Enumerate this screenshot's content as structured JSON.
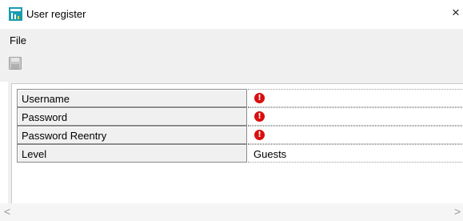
{
  "window": {
    "title": "User register",
    "close_glyph": "×",
    "icon": "app-register-icon"
  },
  "menu": {
    "file_label": "File"
  },
  "toolbar": {
    "save_icon": "save-disk-icon"
  },
  "grid": {
    "rows": [
      {
        "label": "Username",
        "value": "",
        "error": true
      },
      {
        "label": "Password",
        "value": "",
        "error": true
      },
      {
        "label": "Password Reentry",
        "value": "",
        "error": true
      },
      {
        "label": "Level",
        "value": "Guests",
        "error": false
      }
    ],
    "error_glyph": "!"
  },
  "scrollbar": {
    "left_glyph": "<",
    "right_glyph": ">"
  },
  "colors": {
    "error": "#d90f0f",
    "chrome": "#f0f0f0",
    "icon_teal": "#1a9bb0"
  }
}
